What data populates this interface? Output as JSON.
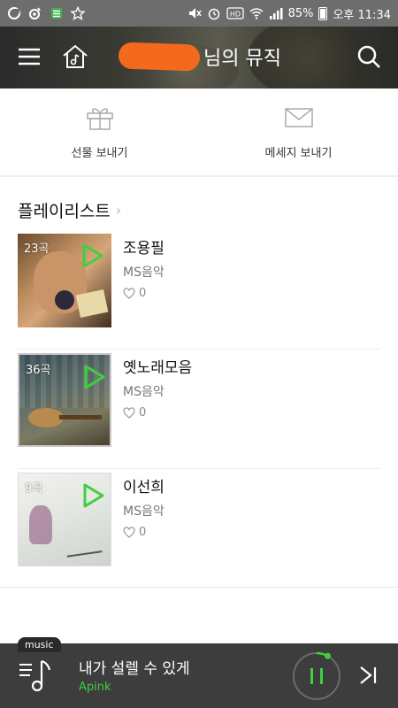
{
  "status_bar": {
    "battery_percent": "85%",
    "time": "오후 11:34",
    "hd_label": "HD"
  },
  "header": {
    "title_suffix": "님의 뮤직",
    "menu_icon": "menu-icon",
    "home_icon": "home-music-icon",
    "search_icon": "search-icon"
  },
  "actions": [
    {
      "label": "선물 보내기",
      "icon": "gift-icon"
    },
    {
      "label": "메세지 보내기",
      "icon": "envelope-icon"
    }
  ],
  "playlists": {
    "title": "플레이리스트",
    "items": [
      {
        "count": "23곡",
        "name": "조용필",
        "artist": "MS음악",
        "likes": "0"
      },
      {
        "count": "36곡",
        "name": "옛노래모음",
        "artist": "MS음악",
        "likes": "0"
      },
      {
        "count": "9곡",
        "name": "이선희",
        "artist": "MS음악",
        "likes": "0"
      }
    ]
  },
  "player": {
    "tag": "music",
    "song": "내가 설렐 수 있게",
    "artist": "Apink",
    "progress": 0.08
  },
  "colors": {
    "accent_green": "#3fcf3f",
    "status_bar": "#6d6d6d",
    "player_bg": "#3d3d3d"
  }
}
